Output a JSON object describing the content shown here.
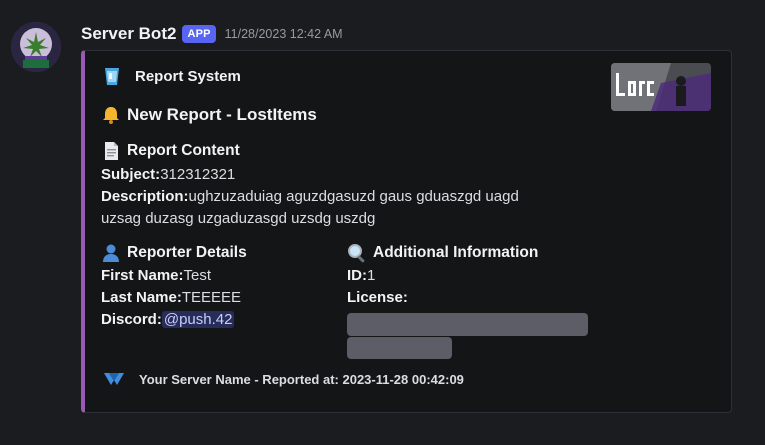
{
  "message": {
    "author": "Server Bot2",
    "badge": "APP",
    "timestamp": "11/28/2023 12:42 AM"
  },
  "embed": {
    "accent_color": "#9b59b6",
    "author_icon": "ice-cube-icon",
    "author_name": "Report System",
    "title_icon": "bell-icon",
    "title": "New Report - LostItems",
    "content": {
      "icon": "page-icon",
      "heading": "Report Content",
      "subject_label": "Subject:",
      "subject_value": "312312321",
      "description_label": "Description:",
      "description_value": "ughzuzaduiag aguzdgasuzd gaus gduaszgd uagd",
      "description_value_2": "uzsag duzasg uzgaduzasgd uzsdg uszdg"
    },
    "reporter": {
      "icon": "person-icon",
      "heading": "Reporter Details",
      "first_name_label": "First Name:",
      "first_name_value": "Test",
      "last_name_label": "Last Name:",
      "last_name_value": "TEEEEE",
      "discord_label": "Discord:",
      "discord_value": "@push.42"
    },
    "additional": {
      "icon": "magnifier-icon",
      "heading": "Additional Information",
      "id_label": "ID:",
      "id_value": "1",
      "license_label": "License:"
    },
    "footer": {
      "icon": "server-logo-icon",
      "text": "Your Server Name - Reported at: 2023-11-28 00:42:09"
    }
  }
}
